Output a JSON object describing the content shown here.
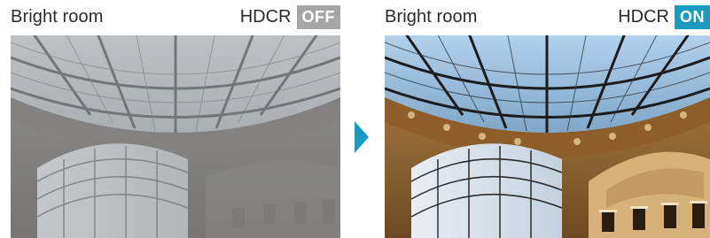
{
  "left_panel": {
    "room_label": "Bright room",
    "hdcr_label": "HDCR",
    "hdcr_state": "OFF",
    "state_color": "#a6a6a6"
  },
  "right_panel": {
    "room_label": "Bright room",
    "hdcr_label": "HDCR",
    "hdcr_state": "ON",
    "state_color": "#1a9bc2"
  },
  "icons": {
    "transition": "arrow-right-icon"
  },
  "colors": {
    "accent": "#1a9bc2",
    "off_badge": "#a6a6a6",
    "text": "#2a2a2a"
  }
}
